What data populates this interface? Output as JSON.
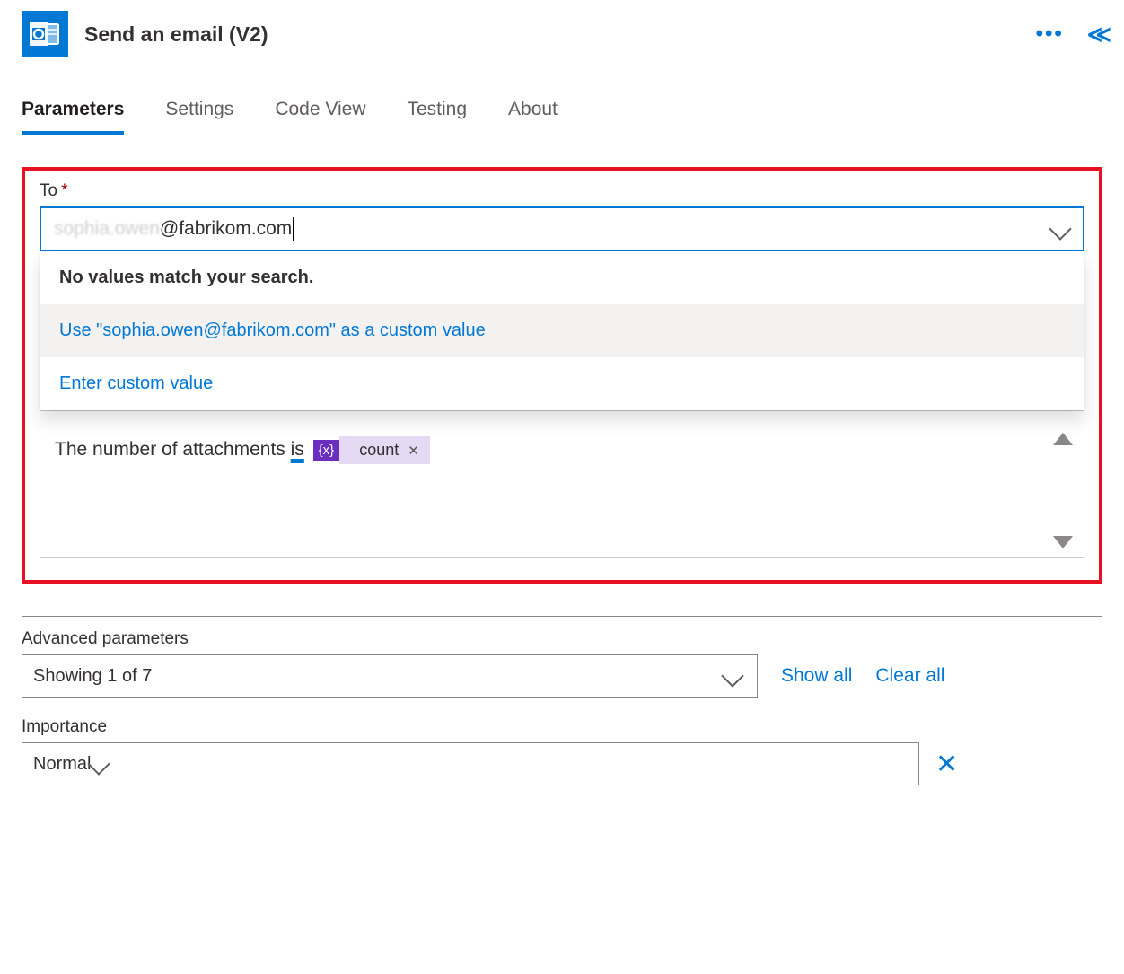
{
  "header": {
    "title": "Send an email (V2)"
  },
  "tabs": {
    "parameters": "Parameters",
    "settings": "Settings",
    "codeview": "Code View",
    "testing": "Testing",
    "about": "About"
  },
  "to": {
    "label": "To",
    "value_blurred": "sophia.owen",
    "value_rest": "@fabrikom.com"
  },
  "dropdown": {
    "no_values": "No values match your search.",
    "use_custom": "Use \"sophia.owen@fabrikom.com\" as a custom value",
    "enter_custom": "Enter custom value"
  },
  "body": {
    "text_prefix": "The number of attachments ",
    "text_is": "is",
    "token_icon": "{x}",
    "token_label": "count"
  },
  "advanced": {
    "section_label": "Advanced parameters",
    "showing": "Showing 1 of 7",
    "show_all": "Show all",
    "clear_all": "Clear all",
    "importance_label": "Importance",
    "importance_value": "Normal"
  }
}
